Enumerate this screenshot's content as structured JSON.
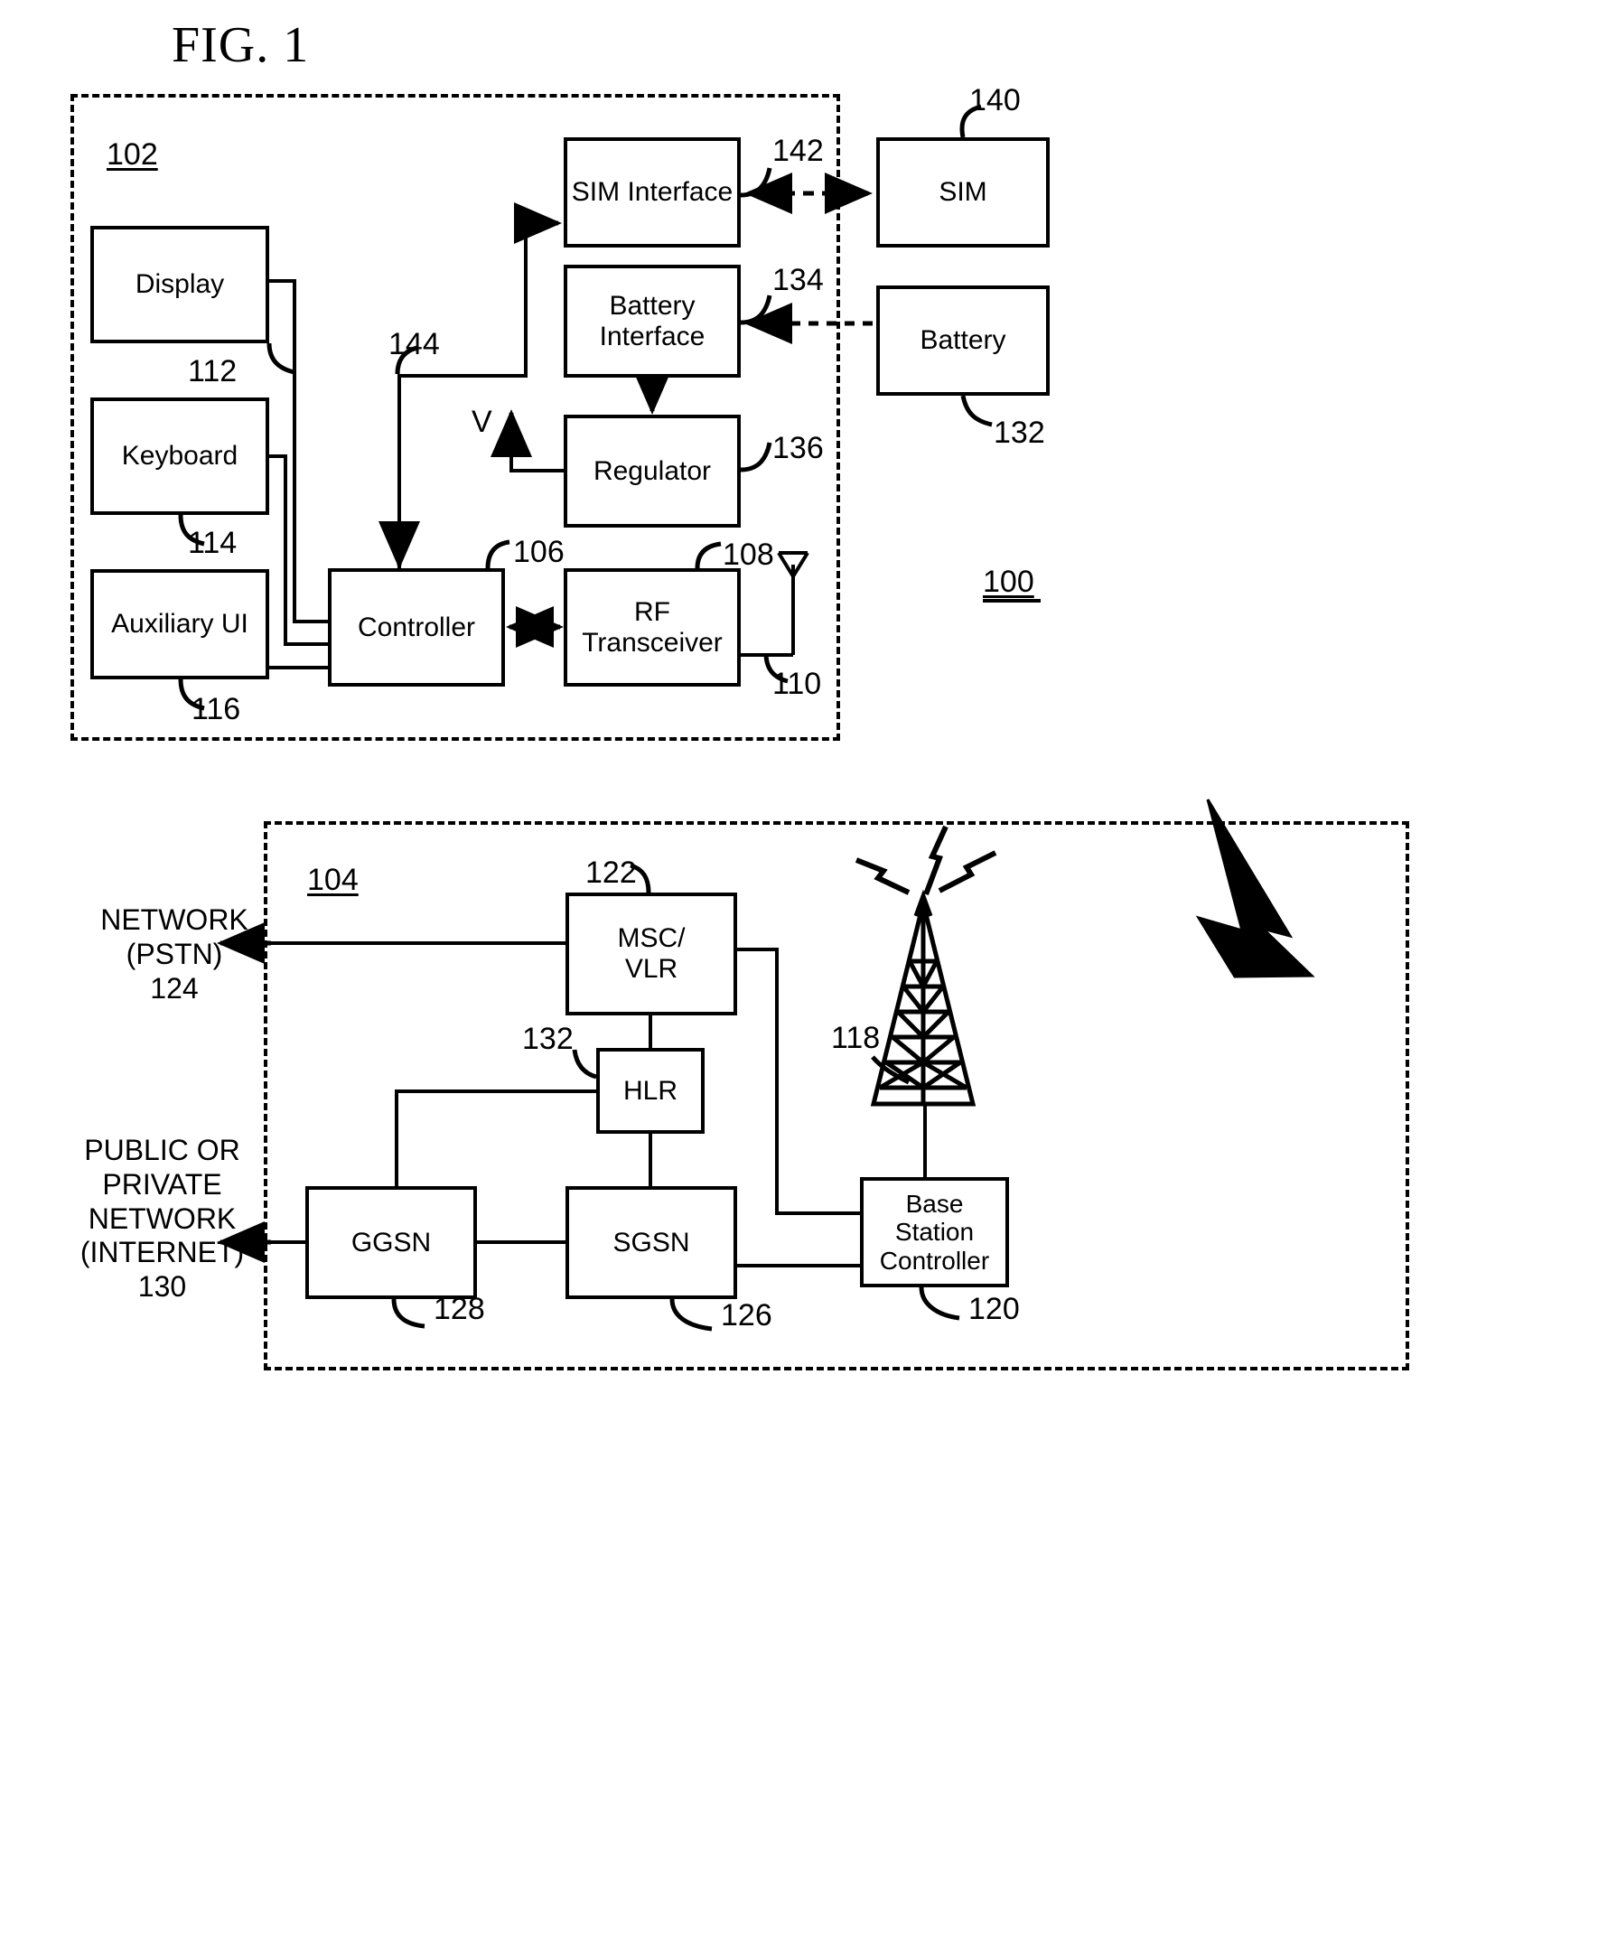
{
  "figure": {
    "title": "FIG. 1",
    "system_ref": "100"
  },
  "mobile_device": {
    "enclosure_ref": "102",
    "blocks": [
      {
        "label": "Display",
        "ref": "112"
      },
      {
        "label": "Keyboard",
        "ref": "114"
      },
      {
        "label": "Auxiliary UI",
        "ref": "116"
      },
      {
        "label": "Controller",
        "ref": "106"
      },
      {
        "label": "RF\nTransceiver",
        "ref": "108"
      },
      {
        "label": "SIM Interface",
        "ref": "142"
      },
      {
        "label": "Battery\nInterface",
        "ref": "134"
      },
      {
        "label": "Regulator",
        "ref": "136"
      }
    ],
    "antenna_ref": "110",
    "bus_ref": "144",
    "voltage_label": "V"
  },
  "external_components": [
    {
      "label": "SIM",
      "ref": "140"
    },
    {
      "label": "Battery",
      "ref": "132"
    }
  ],
  "network": {
    "enclosure_ref": "104",
    "blocks": [
      {
        "label": "MSC/\nVLR",
        "ref": "122"
      },
      {
        "label": "HLR",
        "ref": "132"
      },
      {
        "label": "GGSN",
        "ref": "128"
      },
      {
        "label": "SGSN",
        "ref": "126"
      },
      {
        "label": "Base\nStation\nController",
        "ref": "120"
      }
    ],
    "tower_ref": "118",
    "pstn_label": "NETWORK\n(PSTN)\n124",
    "internet_label": "PUBLIC OR\nPRIVATE\nNETWORK\n(INTERNET)\n130"
  },
  "colors": {
    "ink": "#000000",
    "paper": "#ffffff"
  }
}
